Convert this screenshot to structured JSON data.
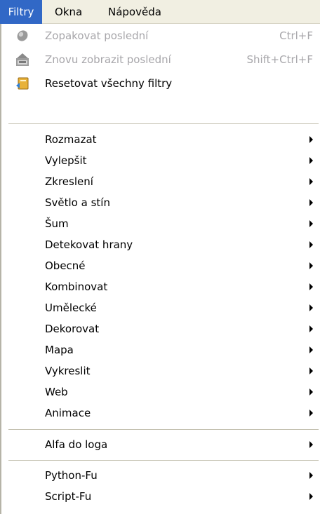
{
  "menubar": {
    "items": [
      {
        "label": "Filtry",
        "active": true
      },
      {
        "label": "Okna",
        "active": false
      },
      {
        "label": "Nápověda",
        "active": false
      }
    ]
  },
  "menu": {
    "top_items": [
      {
        "label": "Zopakovat poslední",
        "shortcut": "Ctrl+F",
        "disabled": true,
        "icon": "repeat-filter-icon"
      },
      {
        "label": "Znovu zobrazit poslední",
        "shortcut": "Shift+Ctrl+F",
        "disabled": true,
        "icon": "reshow-filter-icon"
      },
      {
        "label": "Resetovat všechny filtry",
        "shortcut": "",
        "disabled": false,
        "icon": "reset-filters-icon"
      }
    ],
    "submenus": [
      "Rozmazat",
      "Vylepšit",
      "Zkreslení",
      "Světlo a stín",
      "Šum",
      "Detekovat hrany",
      "Obecné",
      "Kombinovat",
      "Umělecké",
      "Dekorovat",
      "Mapa",
      "Vykreslit",
      "Web",
      "Animace"
    ],
    "logo_group": [
      "Alfa do loga"
    ],
    "script_group": [
      "Python-Fu",
      "Script-Fu"
    ]
  },
  "colors": {
    "active_menu_bg": "#3168c6",
    "menubar_bg": "#f1efe2",
    "disabled_text": "#a7a6aa"
  }
}
